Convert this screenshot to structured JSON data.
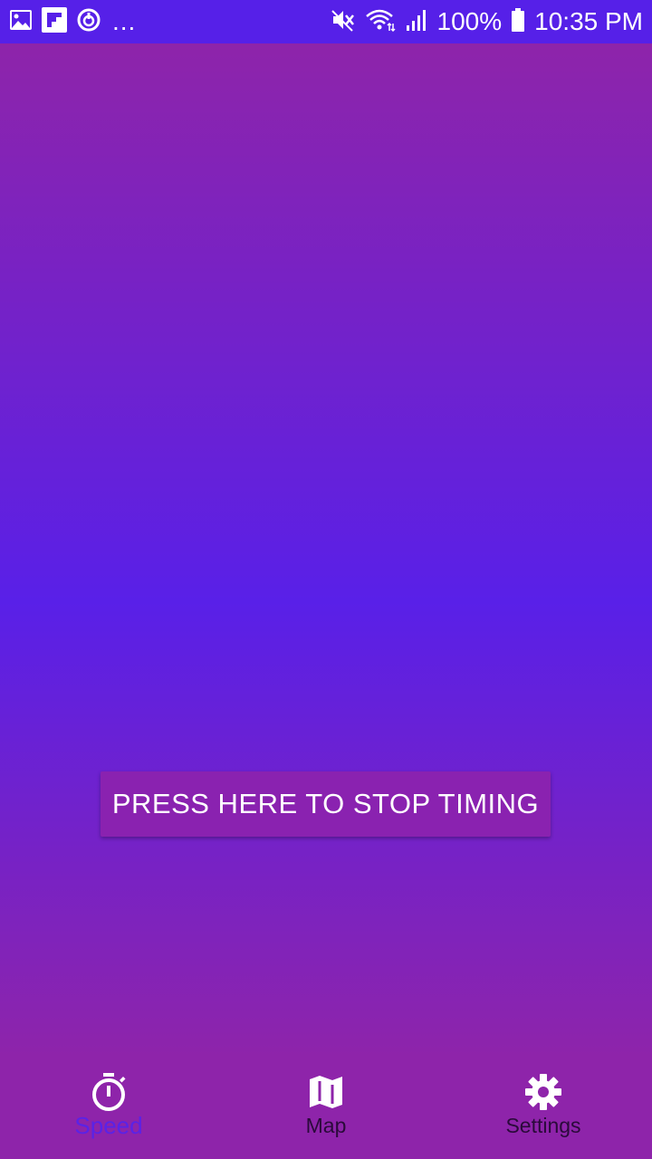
{
  "status_bar": {
    "overflow_indicator": "...",
    "battery_percent": "100%",
    "time": "10:35 PM",
    "left_icons": [
      "gallery-icon",
      "flipboard-icon",
      "sync-icon"
    ],
    "right_icons": [
      "mute-icon",
      "wifi-icon",
      "signal-icon",
      "battery-icon"
    ]
  },
  "main": {
    "stop_button_label": "PRESS HERE TO STOP TIMING"
  },
  "bottom_nav": {
    "items": [
      {
        "label": "Speed",
        "icon": "stopwatch-icon",
        "active": true
      },
      {
        "label": "Map",
        "icon": "map-icon",
        "active": false
      },
      {
        "label": "Settings",
        "icon": "gear-icon",
        "active": false
      }
    ]
  },
  "colors": {
    "status_bar": "#5620E8",
    "gradient_edge": "#8E24AA",
    "gradient_center": "#5920E8",
    "button": "#8A22B0",
    "nav_active": "#5A23E6",
    "nav_inactive": "#2a0a3a"
  }
}
